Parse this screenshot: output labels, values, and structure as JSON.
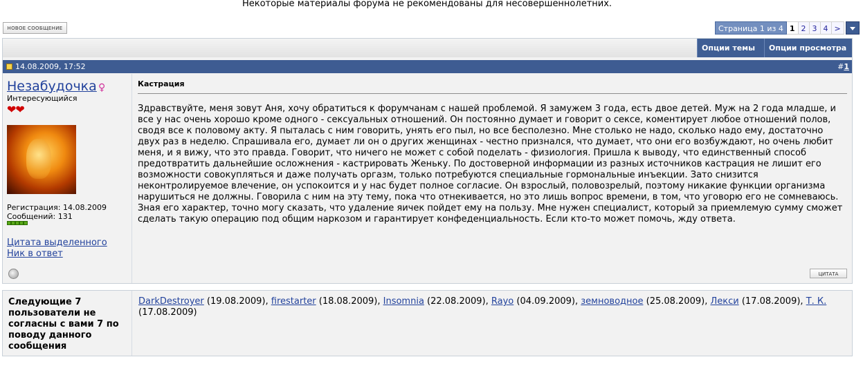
{
  "notice": "Некоторые материалы форума не рекомендованы для несовершеннолетних.",
  "new_post_button": "НОВОЕ СООБЩЕНИЕ",
  "pagination": {
    "title": "Страница 1 из 4",
    "pages": [
      "1",
      "2",
      "3",
      "4",
      ">"
    ],
    "current": "1"
  },
  "toolbar": {
    "thread_options": "Опции темы",
    "view_options": "Опции просмотра"
  },
  "post": {
    "date": "14.08.2009, 17:52",
    "number_prefix": "#",
    "number": "1",
    "author": {
      "name": "Незабудочка",
      "gender_symbol": "♀",
      "title": "Интересующийся",
      "hearts": "❤❤",
      "registration": "Регистрация: 14.08.2009",
      "posts": "Сообщений: 131",
      "reputation_bars": 5
    },
    "quote_selected": "Цитата выделенного",
    "nick_reply": "Ник в ответ",
    "title": "Кастрация",
    "text": "Здравствуйте, меня зовут Аня, хочу обратиться к форумчанам с нашей проблемой. Я замужем 3 года, есть двое детей. Муж на 2 года младше, и все у нас очень хорошо кроме одного - сексуальных отношений. Он постоянно думает и говорит о сексе, коментирует любое отношений полов, сводя все к половому акту. Я пыталась с ним говорить, унять его пыл, но все бесполезно. Мне столько не надо, сколько надо ему, достаточно двух раз в неделю. Спрашивала его, думает ли он о других женщинах - честно признался, что думает, что они его возбуждают, но очень любит меня, и я вижу, что это правда. Говорит, что ничего не может с собой поделать - физиология. Пришла к выводу, что единственный способ предотвратить дальнейшие осложнения - кастрировать Женьку. По достоверной информации из разных источников кастрация не лишит его возможности совокупляться и даже получать оргазм, только потребуются специальные гормональные инъекции. Зато снизится неконтролируемое влечение, он успокоится и у нас будет полное согласие. Он взрослый, половозрелый, поэтому никакие функции организма нарушиться не должны. Говорила с ним на эту тему, пока что отнекивается, но это лишь вопрос времени, в том, что уговорю его не сомневаюсь. Зная его характер, точно могу сказать, что удаление яичек пойдет ему на пользу. Мне нужен специалист, который за приемлемую сумму сможет сделать такую операцию под общим наркозом и гарантирует конфеденциальность. Если кто-то может помочь, жду ответа.",
    "quote_button": "ЦИТАТА"
  },
  "disagree": {
    "label": "Следующие 7 пользователи не согласны с вами 7 по поводу данного сообщения",
    "users": [
      {
        "name": "DarkDestroyer",
        "date": " (19.08.2009), "
      },
      {
        "name": "firestarter",
        "date": " (18.08.2009), "
      },
      {
        "name": "Insomnia",
        "date": " (22.08.2009), "
      },
      {
        "name": "Rayo",
        "date": " (04.09.2009), "
      },
      {
        "name": "земноводное",
        "date": " (25.08.2009), "
      },
      {
        "name": "Лекси",
        "date": " (17.08.2009), "
      },
      {
        "name": "Т. К.",
        "date": " (17.08.2009)"
      }
    ]
  }
}
